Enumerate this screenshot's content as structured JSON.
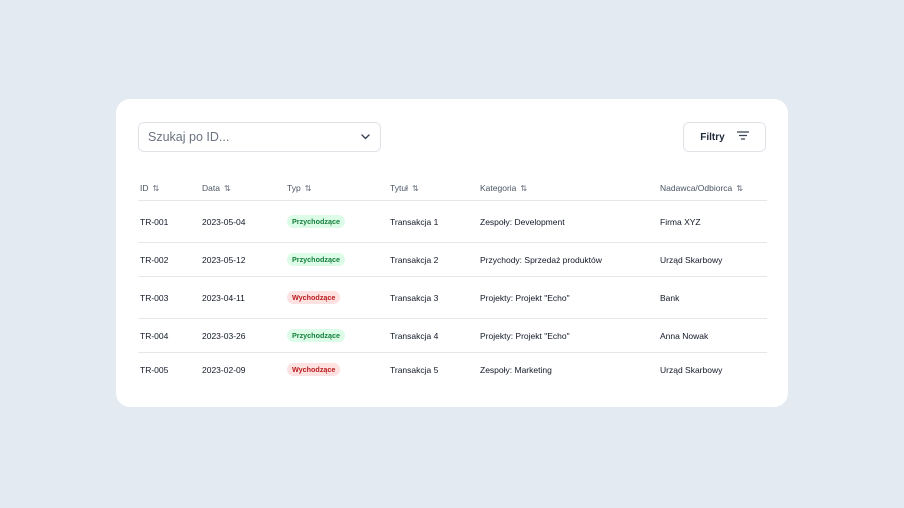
{
  "search": {
    "placeholder": "Szukaj po ID..."
  },
  "filters": {
    "label": "Filtry"
  },
  "columns": {
    "id": "ID",
    "date": "Data",
    "type": "Typ",
    "title": "Tytuł",
    "category": "Kategoria",
    "party": "Nadawca/Odbiorca"
  },
  "rows": [
    {
      "id": "TR-001",
      "date": "2023-05-04",
      "type": "Przychodzące",
      "type_kind": "in",
      "title": "Transakcja 1",
      "category": "Zespoły: Development",
      "party": "Firma XYZ"
    },
    {
      "id": "TR-002",
      "date": "2023-05-12",
      "type": "Przychodzące",
      "type_kind": "in",
      "title": "Transakcja 2",
      "category": "Przychody: Sprzedaż produktów",
      "party": "Urząd Skarbowy"
    },
    {
      "id": "TR-003",
      "date": "2023-04-11",
      "type": "Wychodzące",
      "type_kind": "out",
      "title": "Transakcja 3",
      "category": "Projekty: Projekt \"Echo\"",
      "party": "Bank"
    },
    {
      "id": "TR-004",
      "date": "2023-03-26",
      "type": "Przychodzące",
      "type_kind": "in",
      "title": "Transakcja 4",
      "category": "Projekty: Projekt \"Echo\"",
      "party": "Anna Nowak"
    },
    {
      "id": "TR-005",
      "date": "2023-02-09",
      "type": "Wychodzące",
      "type_kind": "out",
      "title": "Transakcja 5",
      "category": "Zespoły: Marketing",
      "party": "Urząd Skarbowy"
    }
  ],
  "icons": {
    "sort": "sort-arrows-icon",
    "dropdown": "chevron-down-icon",
    "filter": "filter-lines-icon"
  },
  "colors": {
    "badge_in_bg": "#dcfce7",
    "badge_in_text": "#15803d",
    "badge_out_bg": "#fee2e2",
    "badge_out_text": "#b91c1c"
  }
}
